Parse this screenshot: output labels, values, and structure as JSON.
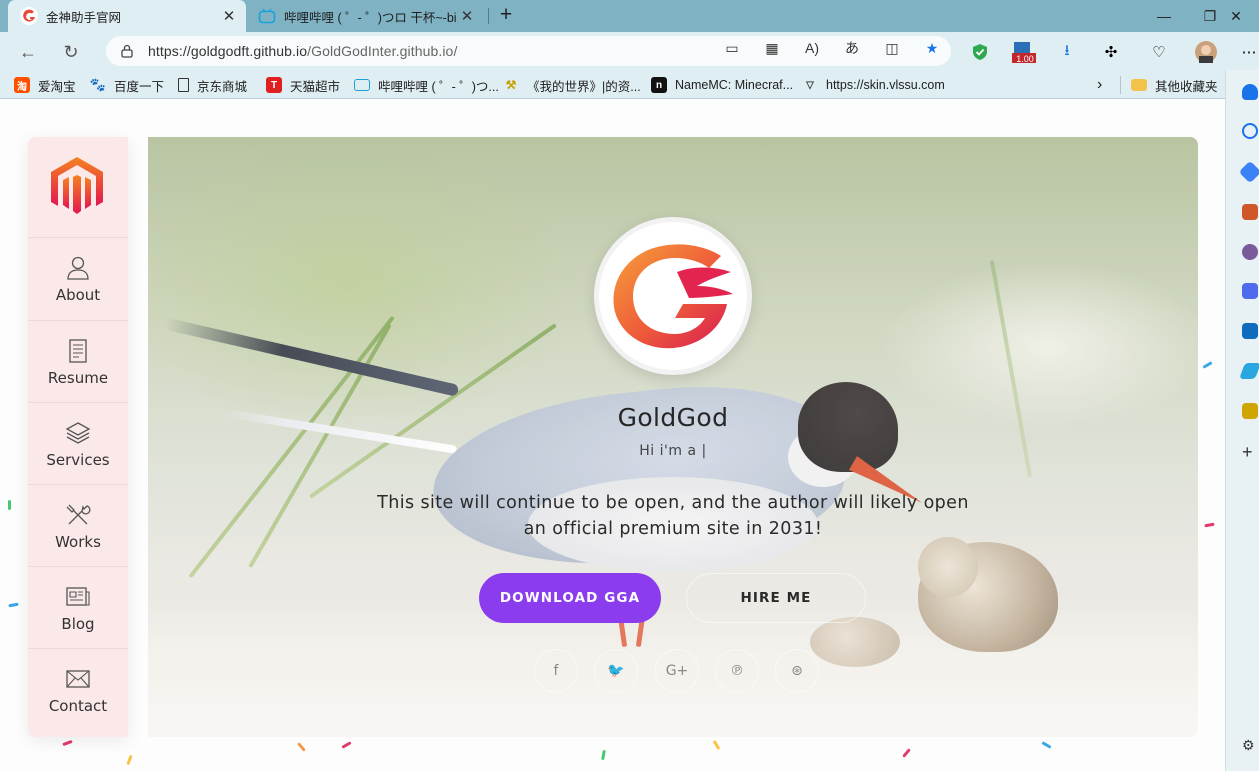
{
  "browser": {
    "tabs": [
      {
        "title": "金神助手官网",
        "active": true
      },
      {
        "title": "哔哩哔哩 ( ゜- ゜)つロ 干杯~-bilibili",
        "active": false
      }
    ],
    "url_host": "https://goldgodft.github.io",
    "url_path": "/GoldGodInter.github.io/",
    "extension_badge": "1.00",
    "bookmarks": [
      {
        "label": "爱淘宝",
        "icon": "taobao-icon"
      },
      {
        "label": "百度一下",
        "icon": "baidu-icon"
      },
      {
        "label": "京东商城",
        "icon": "page-icon"
      },
      {
        "label": "天猫超市",
        "icon": "tmall-icon"
      },
      {
        "label": "哔哩哔哩 ( ゜- ゜)つ...",
        "icon": "bilibili-icon"
      },
      {
        "label": "《我的世界》|的资...",
        "icon": "mcmod-icon"
      },
      {
        "label": "NameMC: Minecraf...",
        "icon": "namemc-icon"
      },
      {
        "label": "https://skin.vlssu.com",
        "icon": "skin-icon"
      }
    ],
    "other_bookmarks": "其他收藏夹"
  },
  "sidebar": {
    "items": [
      {
        "label": "About",
        "icon": "user-icon"
      },
      {
        "label": "Resume",
        "icon": "document-icon"
      },
      {
        "label": "Services",
        "icon": "layers-icon"
      },
      {
        "label": "Works",
        "icon": "tools-icon"
      },
      {
        "label": "Blog",
        "icon": "newspaper-icon"
      },
      {
        "label": "Contact",
        "icon": "mail-icon"
      }
    ]
  },
  "hero": {
    "name": "GoldGod",
    "typed_text": "Hi i'm a |",
    "description": "This site will continue to be open, and the author will likely open an official premium site in 2031!",
    "primary_button": "DOWNLOAD GGA",
    "secondary_button": "HIRE ME",
    "social": [
      {
        "icon": "facebook-icon",
        "glyph": "f"
      },
      {
        "icon": "twitter-icon",
        "glyph": "🐦"
      },
      {
        "icon": "google-plus-icon",
        "glyph": "G+"
      },
      {
        "icon": "pinterest-icon",
        "glyph": "℗"
      },
      {
        "icon": "dribbble-icon",
        "glyph": "⊛"
      }
    ]
  },
  "colors": {
    "accent": "#8b3dee",
    "tabbar": "#7fb3c4",
    "chrome": "#dfeef3",
    "sidenav": "#fbe9ea"
  }
}
